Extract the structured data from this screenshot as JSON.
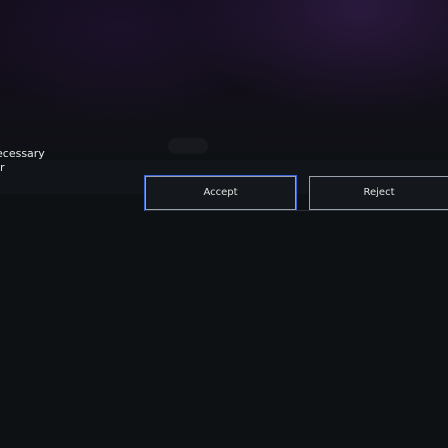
{
  "cookie_notice": {
    "text_line_1": "ecessary",
    "text_line_2": "r"
  },
  "actions": {
    "accept_label": "Accept",
    "reject_label": "Reject"
  },
  "colors": {
    "background": "#0e1114",
    "top_gradient": "#130d1c",
    "button_border": "#9aa3ad",
    "focus_outline": "#3a63d8",
    "text": "#e3e3e3"
  }
}
